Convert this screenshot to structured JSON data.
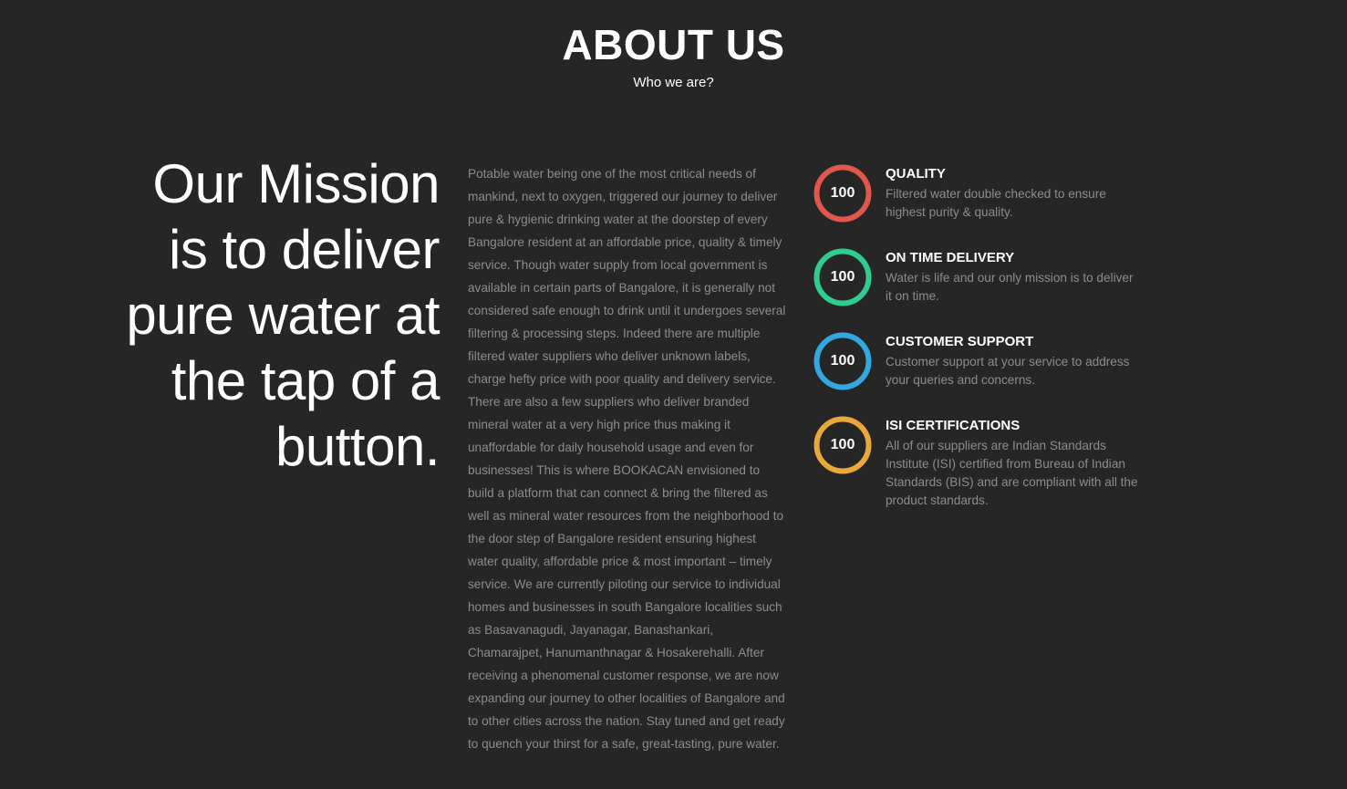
{
  "header": {
    "title": "ABOUT US",
    "subtitle": "Who we are?"
  },
  "mission": {
    "lines": [
      "Our Mission",
      "is to deliver",
      "pure water at",
      "the tap of a",
      "button."
    ]
  },
  "body": {
    "text": "Potable water being one of the most critical needs of mankind, next to oxygen, triggered our journey to deliver pure & hygienic drinking water at the doorstep of every Bangalore resident at an affordable price, quality & timely service. Though water supply from local government is available in certain parts of Bangalore, it is generally not considered safe enough to drink until it undergoes several filtering & processing steps. Indeed there are multiple filtered water suppliers who deliver unknown labels, charge hefty price with poor quality and delivery service. There are also a few suppliers who deliver branded mineral water at a very high price thus making it unaffordable for daily household usage and even for businesses! This is where BOOKACAN envisioned to build a platform that can connect & bring the filtered as well as mineral water resources from the neighborhood to the door step of Bangalore resident ensuring highest water quality, affordable price & most important – timely service. We are currently piloting our service to individual homes and businesses in south Bangalore localities such as Basavanagudi, Jayanagar, Banashankari, Chamarajpet, Hanumanthnagar & Hosakerehalli. After receiving a phenomenal customer response, we are now expanding our journey to other localities of Bangalore and to other cities across the nation. Stay tuned and get ready to quench your thirst for a safe, great-tasting, pure water."
  },
  "features": [
    {
      "value": "100",
      "title": "QUALITY",
      "description": "Filtered water double checked to ensure highest purity & quality.",
      "color": "#e0584b"
    },
    {
      "value": "100",
      "title": "ON TIME DELIVERY",
      "description": "Water is life and our only mission is to deliver it on time.",
      "color": "#2ecc8f"
    },
    {
      "value": "100",
      "title": "CUSTOMER SUPPORT",
      "description": "Customer support at your service to address your queries and concerns.",
      "color": "#33a8e0"
    },
    {
      "value": "100",
      "title": "ISI CERTIFICATIONS",
      "description": "All of our suppliers are Indian Standards Institute (ISI) certified from Bureau of Indian Standards (BIS) and are compliant with all the product standards.",
      "color": "#e8a83c"
    }
  ]
}
